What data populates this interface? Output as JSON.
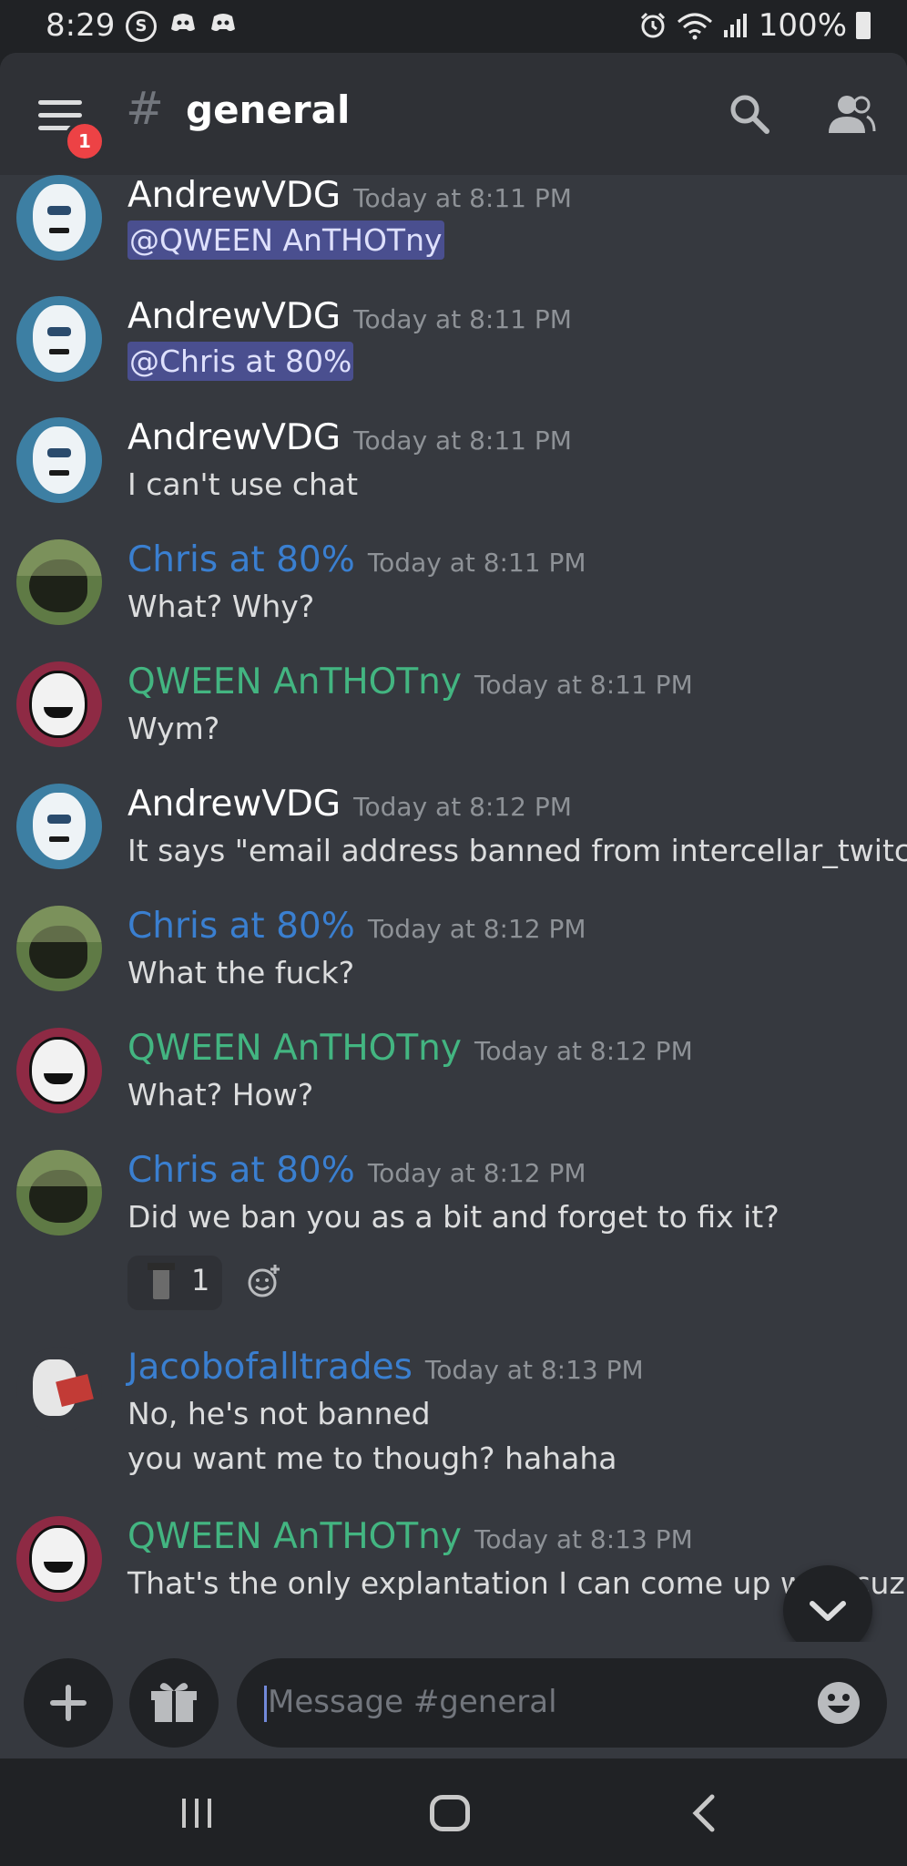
{
  "status_bar": {
    "time": "8:29",
    "app_icon": "S",
    "battery": "100%"
  },
  "header": {
    "channel_hash": "#",
    "channel_name": "general",
    "badge_count": "1"
  },
  "messages": [
    {
      "author": "AndrewVDG",
      "author_color": "#ffffff",
      "timestamp": "Today at 8:11 PM",
      "mention": "@QWEEN AnTHOTny"
    },
    {
      "author": "AndrewVDG",
      "author_color": "#ffffff",
      "timestamp": "Today at 8:11 PM",
      "mention": "@Chris at 80%"
    },
    {
      "author": "AndrewVDG",
      "author_color": "#ffffff",
      "timestamp": "Today at 8:11 PM",
      "text": "I can't use chat"
    },
    {
      "author": "Chris at 80%",
      "author_color": "#3a7fd0",
      "timestamp": "Today at 8:11 PM",
      "text": "What? Why?"
    },
    {
      "author": "QWEEN AnTHOTny",
      "author_color": "#43b581",
      "timestamp": "Today at 8:11 PM",
      "text": "Wym?"
    },
    {
      "author": "AndrewVDG",
      "author_color": "#ffffff",
      "timestamp": "Today at 8:12 PM",
      "text": "It says \"email address banned from intercellar_twitch\""
    },
    {
      "author": "Chris at 80%",
      "author_color": "#3a7fd0",
      "timestamp": "Today at 8:12 PM",
      "text": "What the fuck?"
    },
    {
      "author": "QWEEN AnTHOTny",
      "author_color": "#43b581",
      "timestamp": "Today at 8:12 PM",
      "text": "What? How?"
    },
    {
      "author": "Chris at 80%",
      "author_color": "#3a7fd0",
      "timestamp": "Today at 8:12 PM",
      "text": "Did we ban you as a bit and forget to fix it?",
      "reaction_count": "1"
    },
    {
      "author": "Jacobofalltrades",
      "author_color": "#3a7fd0",
      "timestamp": "Today at 8:13 PM",
      "text": "No, he's not banned",
      "text2": "you want me to though? hahaha"
    },
    {
      "author": "QWEEN AnTHOTny",
      "author_color": "#43b581",
      "timestamp": "Today at 8:13 PM",
      "text": "That's the only explantation I can come up with cuz"
    }
  ],
  "composer": {
    "placeholder": "Message #general"
  },
  "icons": {
    "menu": "hamburger-icon",
    "search": "search-icon",
    "members": "members-icon",
    "add": "plus-icon",
    "gift": "gift-icon",
    "emoji": "emoji-icon",
    "scroll": "chevron-down-icon"
  }
}
